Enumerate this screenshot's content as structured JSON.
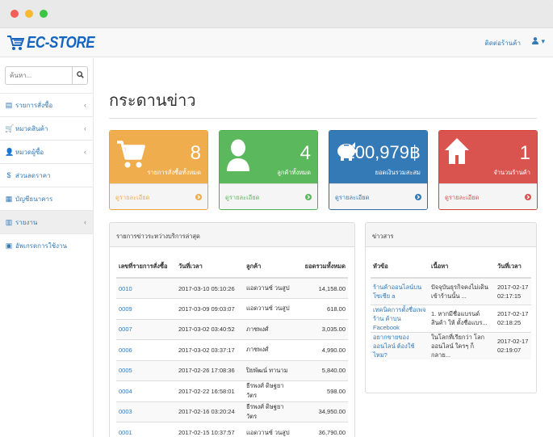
{
  "brand": {
    "logo_text": "EC-STORE"
  },
  "navbar": {
    "contact_link": "ติดต่อร้านค้า",
    "user_caret": "▾"
  },
  "sidebar": {
    "search_placeholder": "ค้นหา...",
    "items": [
      {
        "label": "รายการสั่งซื้อ",
        "icon": "list-icon",
        "glyph": "▤",
        "chev": "‹",
        "active": false
      },
      {
        "label": "หมวดสินค้า",
        "icon": "cart-icon",
        "glyph": "🛒",
        "chev": "‹",
        "active": false
      },
      {
        "label": "หมวดผู้ซื้อ",
        "icon": "user-icon",
        "glyph": "👤",
        "chev": "‹",
        "active": false
      },
      {
        "label": "ส่วนลดราคา",
        "icon": "dollar-icon",
        "glyph": "$",
        "chev": "",
        "active": false
      },
      {
        "label": "บัญชีธนาคาร",
        "icon": "bank-icon",
        "glyph": "▦",
        "chev": "",
        "active": false
      },
      {
        "label": "รายงาน",
        "icon": "report-icon",
        "glyph": "▥",
        "chev": "‹",
        "active": true
      },
      {
        "label": "อัพเกรดการใช้งาน",
        "icon": "upgrade-icon",
        "glyph": "▣",
        "chev": "",
        "active": false
      }
    ]
  },
  "main": {
    "title": "กระดานข่าว",
    "cards": [
      {
        "value": "8",
        "label": "รายการสั่งซื้อทั้งหมด",
        "footer": "ดูรายละเอียด",
        "color": "#f0ad4e",
        "border": "#eea236",
        "icon": "cart-icon"
      },
      {
        "value": "4",
        "label": "ลูกค้าทั้งหมด",
        "footer": "ดูรายละเอียด",
        "color": "#5cb85c",
        "border": "#4cae4c",
        "icon": "user-icon"
      },
      {
        "value": "100,979฿",
        "label": "ยอดเงินรวมสะสม",
        "footer": "ดูรายละเอียด",
        "color": "#337ab7",
        "border": "#2e6da4",
        "icon": "piggy-bank-icon"
      },
      {
        "value": "1",
        "label": "จำนวนร้านค้า",
        "footer": "ดูรายละเอียด",
        "color": "#d9534f",
        "border": "#d43f3a",
        "icon": "home-icon"
      }
    ],
    "orders_panel": {
      "title": "รายการข่าวระหว่างบริการล่าสุด",
      "headers": [
        "เลขที่รายการสั่งซื้อ",
        "วันที่เวลา",
        "ลูกค้า",
        "ยอดรวมทั้งหมด"
      ],
      "rows": [
        [
          "0010",
          "2017-03-10 05:10:26",
          "แอดวานซ์ วนสูป",
          "14,158.00"
        ],
        [
          "0009",
          "2017-03-09 09:03:07",
          "แอดวานซ์ วนสูป",
          "618.00"
        ],
        [
          "0007",
          "2017-03-02 03:40:52",
          "ภาชพงศ์",
          "3,035.00"
        ],
        [
          "0006",
          "2017-03-02 03:37:17",
          "ภาชพงศ์",
          "4,990.00"
        ],
        [
          "0005",
          "2017-02-26 17:08:36",
          "ปิยพัฒน์ ทานาม",
          "5,840.00"
        ],
        [
          "0004",
          "2017-02-22 16:58:01",
          "ธีรพงศ์ ดิษฐยาวัตร",
          "598.00"
        ],
        [
          "0003",
          "2017-02-16 03:20:24",
          "ธีรพงศ์ ดิษฐยาวัตร",
          "34,950.00"
        ],
        [
          "0001",
          "2017-02-15 10:37:57",
          "แอดวานซ์ วนสูป",
          "36,790.00"
        ]
      ]
    },
    "news_panel": {
      "title": "ข่าวสาร",
      "headers": [
        "หัวข้อ",
        "เนื้อหา",
        "วันที่เวลา"
      ],
      "rows": [
        {
          "topic": "ร้านค้าออนไลน์บนโซเชีย a",
          "content": "ปัจจุบันธุรกิจคงไม่เดิน เข้าร้านนั้น ...",
          "date": "2017-02-17",
          "time": "02:17:15"
        },
        {
          "topic": "เทคนิคการตั้งชื่อเพจร้าน ค้าบน Facebook",
          "content": "1. หากมีชื่อแบรนด์สินค้า ให้ ตั้งชื่อแบร...",
          "date": "2017-02-17",
          "time": "02:18:25"
        },
        {
          "topic": "อยากขายของออนไลน์ ต้องใช้ไหม?",
          "content": "ในโลกที่เรียกว่า โลก ออนไลน์ ใครๆ ก็กลาย...",
          "date": "2017-02-17",
          "time": "02:19:07"
        }
      ]
    }
  }
}
